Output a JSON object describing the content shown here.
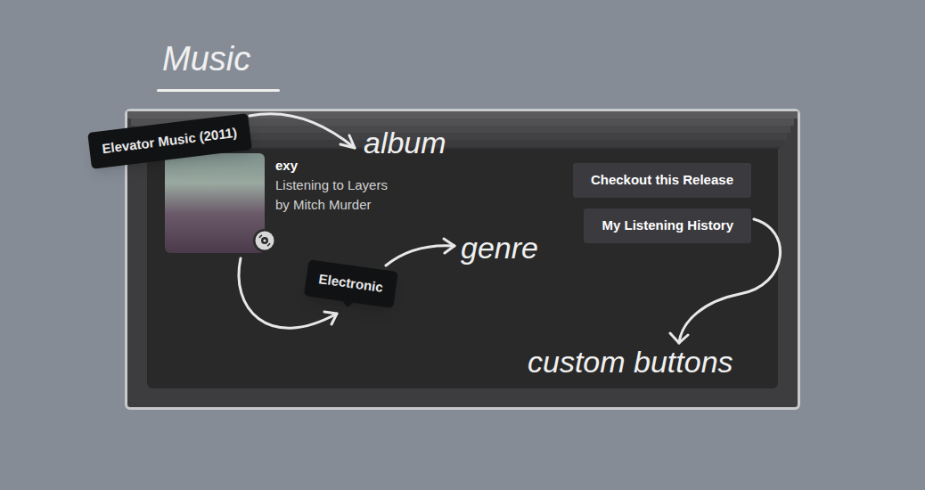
{
  "title": "Music",
  "annotations": {
    "album": "album",
    "genre": "genre",
    "buttons": "custom buttons"
  },
  "activity": {
    "name": "exy",
    "details": "Listening to Layers",
    "state": "by Mitch Murder"
  },
  "tooltips": {
    "album": "Elevator Music (2011)",
    "genre": "Electronic"
  },
  "buttons": [
    "Checkout this Release",
    "My Listening History"
  ]
}
